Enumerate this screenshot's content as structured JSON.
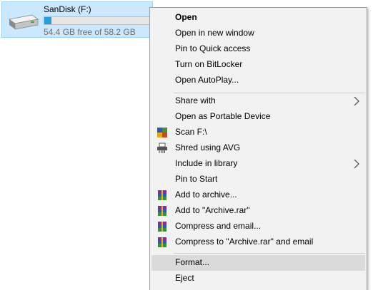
{
  "drive": {
    "name": "SanDisk (F:)",
    "free_text": "54.4 GB free of 58.2 GB",
    "used_fraction": 0.065,
    "icon": "usb-drive-icon",
    "bar_color": "#26a0da"
  },
  "menu": {
    "items": [
      {
        "label": "Open",
        "bold": true
      },
      {
        "label": "Open in new window"
      },
      {
        "label": "Pin to Quick access"
      },
      {
        "label": "Turn on BitLocker"
      },
      {
        "label": "Open AutoPlay..."
      },
      {
        "label": "Share with",
        "submenu": true
      },
      {
        "label": "Open as Portable Device"
      },
      {
        "label": "Scan F:\\",
        "icon": "avg-scan-icon"
      },
      {
        "label": "Shred using AVG",
        "icon": "shredder-icon"
      },
      {
        "label": "Include in library",
        "submenu": true
      },
      {
        "label": "Pin to Start"
      },
      {
        "label": "Add to archive...",
        "icon": "winrar-icon"
      },
      {
        "label": "Add to \"Archive.rar\"",
        "icon": "winrar-icon"
      },
      {
        "label": "Compress and email...",
        "icon": "winrar-icon"
      },
      {
        "label": "Compress to \"Archive.rar\" and email",
        "icon": "winrar-icon"
      },
      {
        "label": "Format...",
        "highlighted": true
      },
      {
        "label": "Eject"
      }
    ]
  },
  "colors": {
    "selection_bg": "#cce8ff",
    "menu_bg": "#f2f2f2",
    "hover_bg": "#dadada"
  }
}
